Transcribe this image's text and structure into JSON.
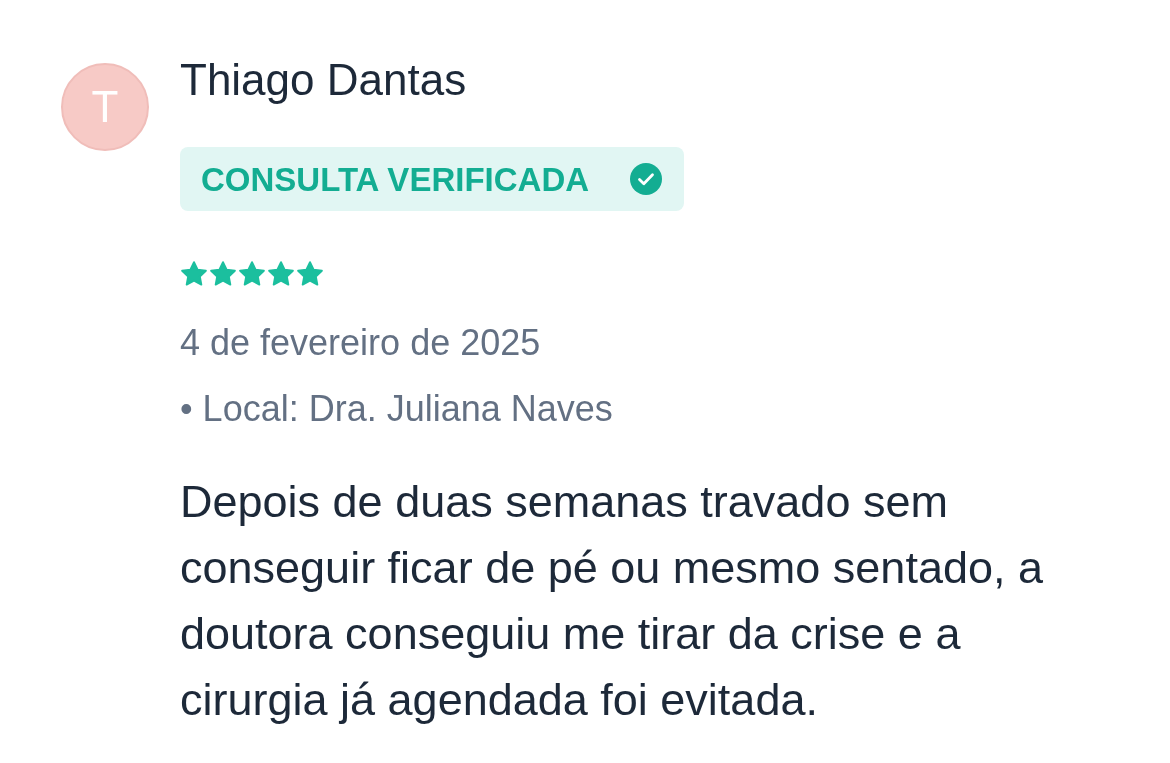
{
  "review": {
    "avatar_initial": "T",
    "author": "Thiago Dantas",
    "badge": "CONSULTA VERIFICADA",
    "stars": 5,
    "date": "4 de fevereiro de 2025",
    "location": "• Local: Dra. Juliana Naves",
    "text": "Depois de duas semanas travado sem conseguir ficar de pé ou mesmo sentado, a doutora conseguiu me tirar da crise e a cirurgia já agendada foi evitada."
  }
}
